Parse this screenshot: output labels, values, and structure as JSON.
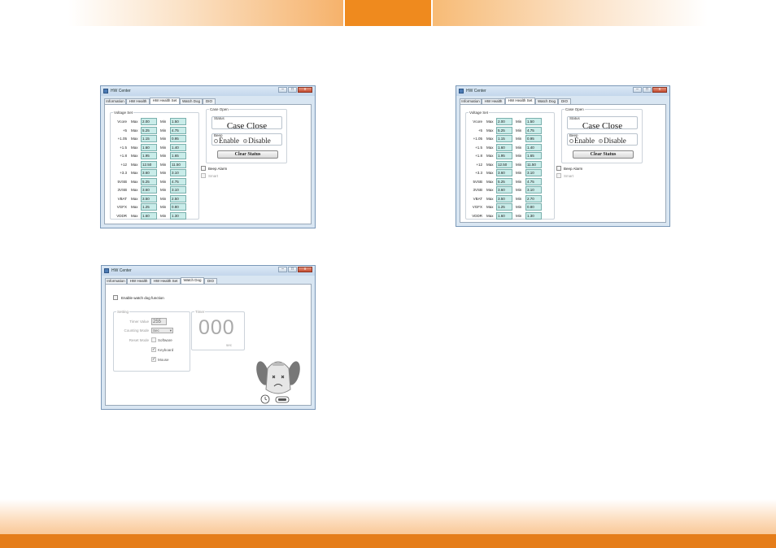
{
  "window_title": "HW Center",
  "tabs": [
    "Information",
    "HW Health",
    "HW Health Set",
    "Watch Dog",
    "DIO"
  ],
  "voltage": {
    "group_label": "Voltage Set",
    "max_label": "Max",
    "min_label": "Min",
    "rows_1": [
      {
        "name": "Vcore",
        "max": "2.00",
        "min": "1.50"
      },
      {
        "name": "+5",
        "max": "5.25",
        "min": "4.75"
      },
      {
        "name": "+1.05",
        "max": "1.15",
        "min": "0.95"
      },
      {
        "name": "+1.5",
        "max": "1.60",
        "min": "1.40"
      },
      {
        "name": "+1.8",
        "max": "1.95",
        "min": "1.65"
      },
      {
        "name": "+12",
        "max": "12.50",
        "min": "11.50"
      },
      {
        "name": "+3.3",
        "max": "3.60",
        "min": "3.10"
      },
      {
        "name": "5VSB",
        "max": "5.25",
        "min": "4.75"
      },
      {
        "name": "3VSB",
        "max": "3.60",
        "min": "3.10"
      },
      {
        "name": "VBAT",
        "max": "3.50",
        "min": "2.50"
      },
      {
        "name": "VGFX",
        "max": "1.25",
        "min": "0.80"
      },
      {
        "name": "VDDR",
        "max": "1.60",
        "min": "1.30"
      }
    ],
    "rows_2": [
      {
        "name": "Vcore",
        "max": "2.00",
        "min": "1.50"
      },
      {
        "name": "+5",
        "max": "5.25",
        "min": "4.75"
      },
      {
        "name": "+1.05",
        "max": "1.15",
        "min": "0.95"
      },
      {
        "name": "+1.5",
        "max": "1.60",
        "min": "1.40"
      },
      {
        "name": "+1.8",
        "max": "1.95",
        "min": "1.65"
      },
      {
        "name": "+12",
        "max": "12.50",
        "min": "11.50"
      },
      {
        "name": "+3.3",
        "max": "3.60",
        "min": "3.10"
      },
      {
        "name": "5VSB",
        "max": "5.25",
        "min": "4.75"
      },
      {
        "name": "3VSB",
        "max": "3.60",
        "min": "3.10"
      },
      {
        "name": "VBAT",
        "max": "3.50",
        "min": "2.70"
      },
      {
        "name": "VGFX",
        "max": "1.25",
        "min": "0.80"
      },
      {
        "name": "VDDR",
        "max": "1.60",
        "min": "1.30"
      }
    ]
  },
  "case_open": {
    "group_label": "Case Open",
    "status_label": "Status",
    "status_value": "Case Close",
    "beep_label": "Beep",
    "enable": "Enable",
    "disable": "Disable",
    "clear_button": "Clear Status"
  },
  "beep_alarm": "Beep Alarm",
  "smart": "Smart",
  "watchdog": {
    "enable_label": "Enable watch dog function",
    "setting_label": "Setting",
    "timer_value_label": "Timer Value",
    "timer_value": "255",
    "counting_mode_label": "Counting Mode",
    "counting_mode": "Sec",
    "reset_mode_label": "Reset Mode",
    "software": "Software",
    "keyboard": "Keyboard",
    "mouse": "Mouse",
    "timer_label": "Timer",
    "timer_display": "000",
    "timer_unit": "sec"
  },
  "colors": {
    "accent": "#ef8a1e",
    "footer": "#e57d1a",
    "field": "#c9ece9"
  }
}
